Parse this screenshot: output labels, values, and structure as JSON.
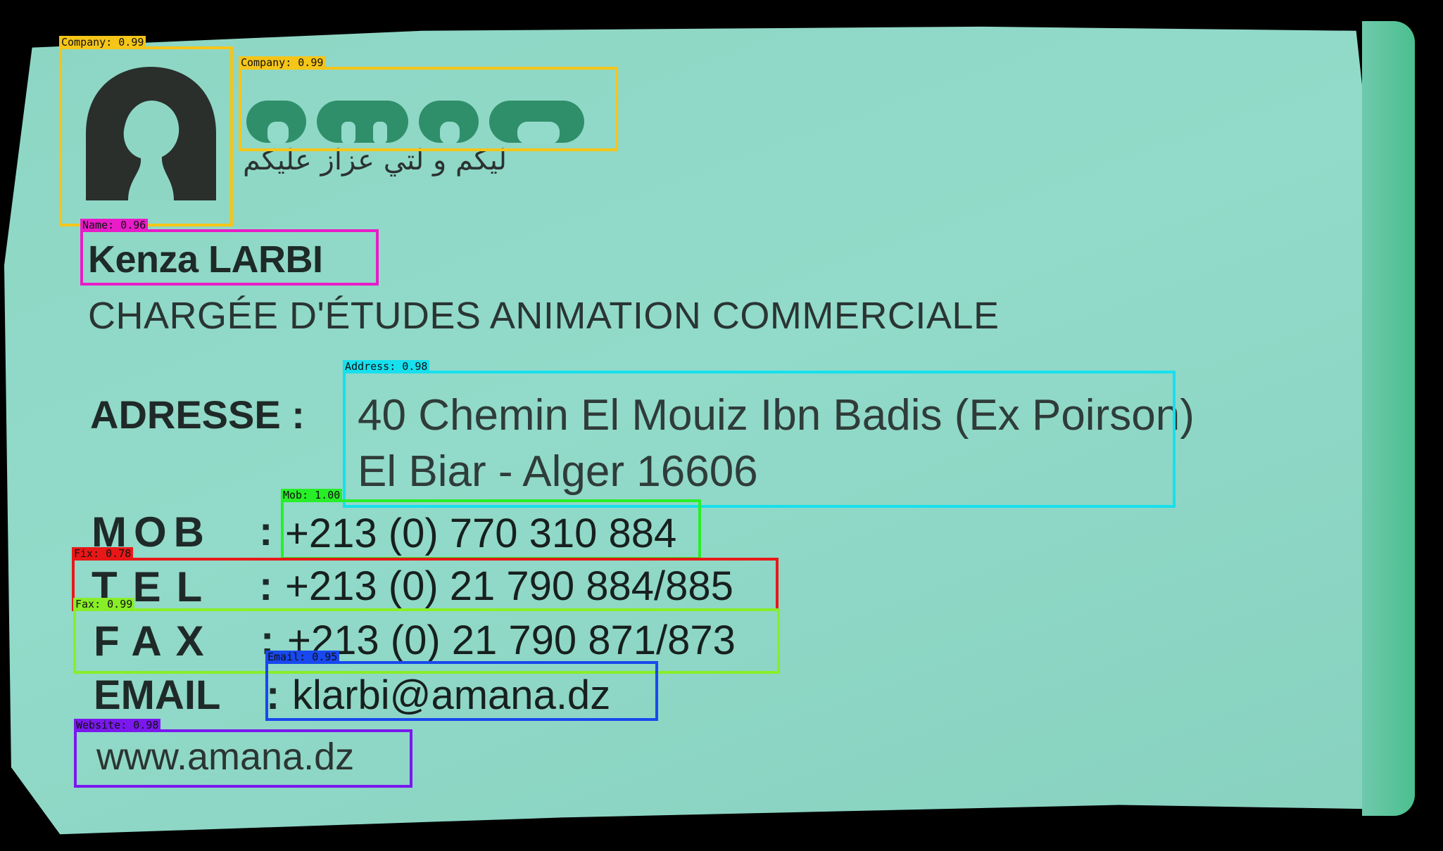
{
  "card": {
    "logo_tagline": "ليكم و لتي عزاز عليكم",
    "logo_word": "amana",
    "name": "Kenza LARBI",
    "title": "CHARGÉE D'ÉTUDES ANIMATION COMMERCIALE",
    "address_label": "ADRESSE :",
    "address_line1": "40 Chemin El Mouiz Ibn Badis (Ex Poirson)",
    "address_line2": "El Biar - Alger 16606",
    "mob_label": "MOB",
    "mob_value": "+213 (0) 770 310 884",
    "tel_label": "TEL",
    "tel_value": "+213 (0) 21 790 884/885",
    "fax_label": "FAX",
    "fax_value": "+213 (0) 21 790 871/873",
    "email_label": "EMAIL",
    "email_value": "klarbi@amana.dz",
    "website": "www.amana.dz",
    "colon": ":"
  },
  "detections": [
    {
      "label": "Company: 0.99",
      "color": "#f5c518"
    },
    {
      "label": "Company: 0.99",
      "color": "#f5c518"
    },
    {
      "label": "Name: 0.96",
      "color": "#e81cc8"
    },
    {
      "label": "Address: 0.98",
      "color": "#16e0ee"
    },
    {
      "label": "Mob: 1.00",
      "color": "#28ee28"
    },
    {
      "label": "Fix: 0.78",
      "color": "#e81818"
    },
    {
      "label": "Fax: 0.99",
      "color": "#88ee28"
    },
    {
      "label": "Email: 0.95",
      "color": "#1848ee"
    },
    {
      "label": "Website: 0.98",
      "color": "#7a18ee"
    }
  ]
}
